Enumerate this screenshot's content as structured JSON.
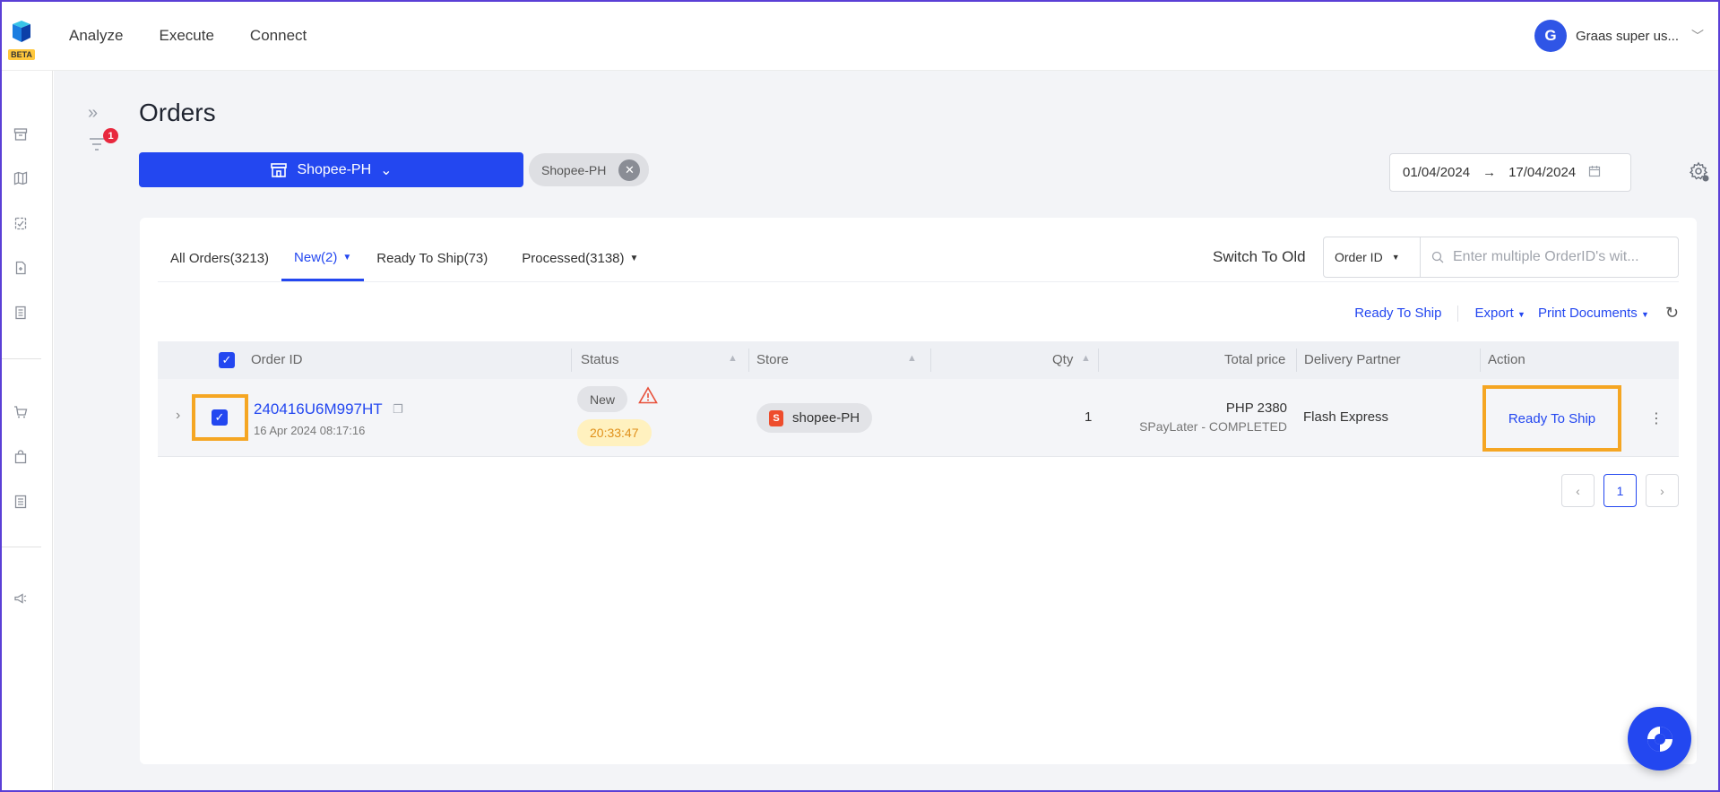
{
  "app": {
    "logo_badge": "BETA",
    "nav": [
      "Analyze",
      "Execute",
      "Connect"
    ],
    "user": {
      "initial": "G",
      "name": "Graas super us..."
    }
  },
  "colors": {
    "primary": "#2347f0",
    "highlight": "#f5a623",
    "danger": "#e8283e",
    "shopee": "#ee4d2d"
  },
  "sidebar_icons": [
    "archive-icon",
    "map-icon",
    "clipboard-check-icon",
    "file-add-icon",
    "document-icon",
    "cart-icon",
    "bag-icon",
    "list-icon",
    "megaphone-icon"
  ],
  "page": {
    "title": "Orders",
    "filter_count": "1",
    "store_selector": "Shopee-PH",
    "store_chip": "Shopee-PH",
    "date_from": "01/04/2024",
    "date_arrow": "→",
    "date_to": "17/04/2024"
  },
  "tabs": [
    {
      "label": "All Orders(3213)",
      "dropdown": false
    },
    {
      "label": "New(2)",
      "dropdown": true,
      "active": true
    },
    {
      "label": "Ready To Ship(73)",
      "dropdown": false
    },
    {
      "label": "Processed(3138)",
      "dropdown": true
    }
  ],
  "toolbar": {
    "switch_old": "Switch To Old",
    "search_field": "Order ID",
    "search_placeholder": "Enter multiple OrderID's wit...",
    "ready_to_ship": "Ready To Ship",
    "export": "Export",
    "print_documents": "Print Documents"
  },
  "table": {
    "columns": [
      "Order ID",
      "Status",
      "Store",
      "Qty",
      "Total price",
      "Delivery Partner",
      "Action"
    ],
    "rows": [
      {
        "order_id": "240416U6M997HT",
        "date": "16 Apr 2024 08:17:16",
        "status": "New",
        "timer": "20:33:47",
        "store": "shopee-PH",
        "qty": "1",
        "price": "PHP 2380",
        "payment": "SPayLater - COMPLETED",
        "partner": "Flash Express",
        "action": "Ready To Ship"
      }
    ]
  },
  "pagination": {
    "current": "1"
  }
}
